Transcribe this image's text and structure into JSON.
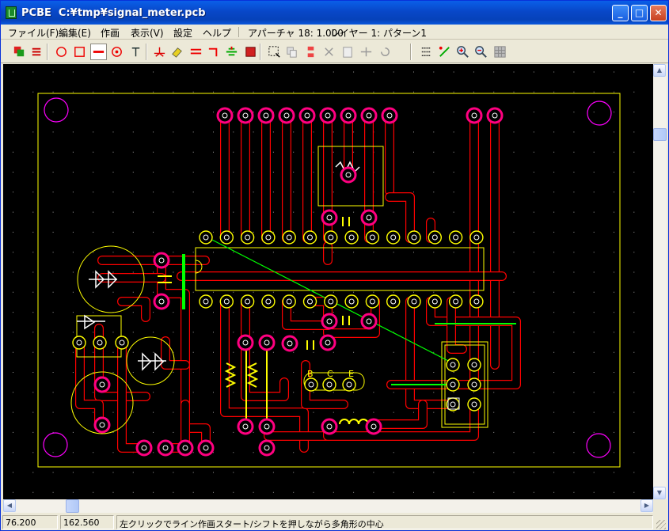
{
  "window": {
    "app_name": "PCBE",
    "file_path": "C:¥tmp¥signal_meter.pcb"
  },
  "title_buttons": {
    "minimize": "_",
    "maximize": "□",
    "close": "✕"
  },
  "menu": [
    "ファイル(F)",
    "編集(E)",
    "作画",
    "表示(V)",
    "設定",
    "ヘルプ"
  ],
  "menu_info": {
    "aperture": "アパーチャ 18: 1.000",
    "layer": "レイヤー 1: パターン1"
  },
  "toolbar_icons": [
    "layers-icon",
    "flip-icon",
    "circle-tool-icon",
    "rect-tool-icon",
    "line-tool-icon",
    "pad-tool-icon",
    "text-tool-icon",
    "junction-icon",
    "eraser-icon",
    "parallel-icon",
    "corner-icon",
    "align-icon",
    "fill-icon",
    "select-area-icon",
    "copy-icon",
    "layer-swap-icon",
    "cut-icon",
    "paste-icon",
    "mirror-icon",
    "rotate-icon",
    "list-icon",
    "measure-icon",
    "zoom-in-icon",
    "zoom-out-icon",
    "grid-icon"
  ],
  "canvas": {
    "background": "#000000",
    "outline_color": "#ffff00",
    "trace_color": "#ff0000",
    "pad_color": "#ff0080",
    "ratsnest_color": "#00ff00",
    "board_labels": [
      "B",
      "C",
      "E"
    ]
  },
  "status": {
    "x": "76.200",
    "y": "162.560",
    "message": "左クリックでライン作画スタート/シフトを押しながら多角形の中心"
  }
}
